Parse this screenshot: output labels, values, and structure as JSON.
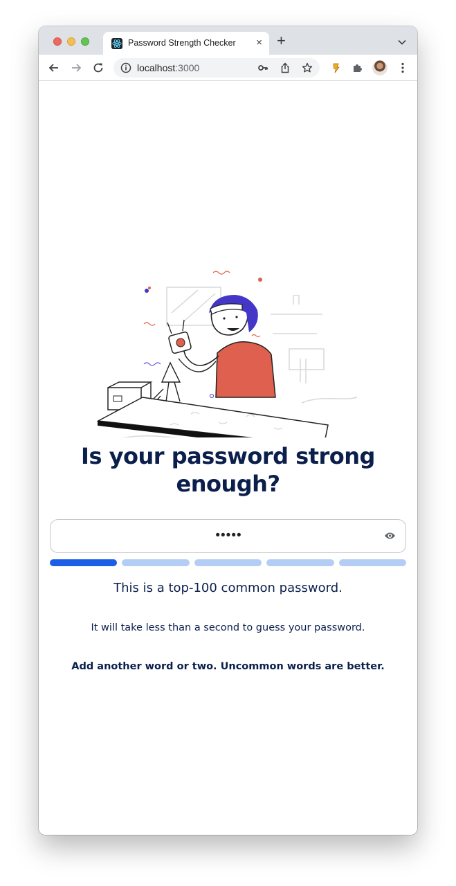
{
  "browser": {
    "tab_title": "Password Strength Checker",
    "tab_close": "×",
    "new_tab": "+",
    "url_host": "localhost",
    "url_port": ":3000"
  },
  "icons": [
    "react-favicon-icon",
    "back-icon",
    "forward-icon",
    "reload-icon",
    "info-icon",
    "key-icon",
    "share-icon",
    "star-icon",
    "extension-icon",
    "puzzle-icon",
    "avatar",
    "more-icon",
    "eye-icon"
  ],
  "main": {
    "headline": "Is your password strong enough?",
    "password_masked": "•••••",
    "strength_level": 1,
    "strength_segments": 5,
    "colors": {
      "active": "#1a5fe6",
      "inactive": "#b4cdf5",
      "text": "#0b1f4c"
    },
    "message": "This is a top-100 common password.",
    "crack_time": "It will take less than a second to guess your password.",
    "suggestion": "Add another word or two. Uncommon words are better."
  }
}
